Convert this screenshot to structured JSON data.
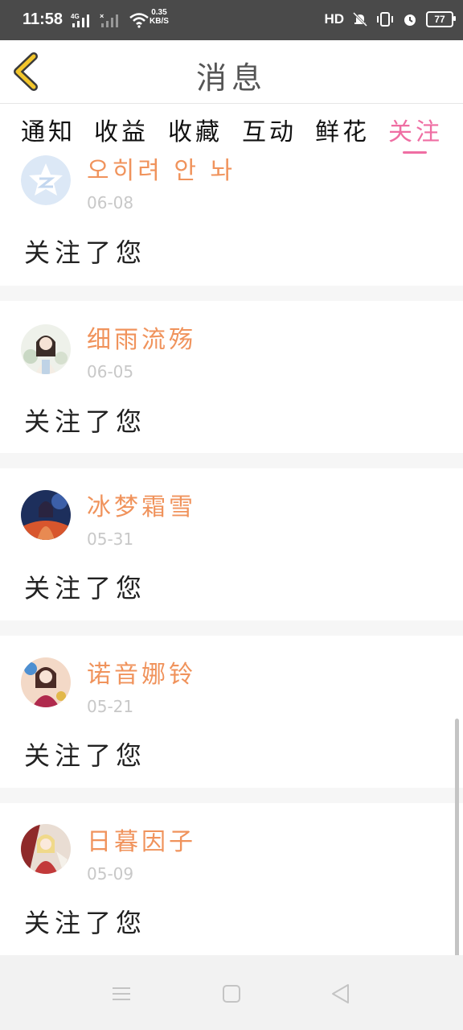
{
  "status": {
    "time": "11:58",
    "speed_value": "0.35",
    "speed_unit": "KB/S",
    "hd_label": "HD",
    "battery": "77"
  },
  "header": {
    "title": "消息"
  },
  "tabs": [
    {
      "label": "通知",
      "active": false
    },
    {
      "label": "收益",
      "active": false
    },
    {
      "label": "收藏",
      "active": false
    },
    {
      "label": "互动",
      "active": false
    },
    {
      "label": "鲜花",
      "active": false
    },
    {
      "label": "关注",
      "active": true
    }
  ],
  "colors": {
    "accent_pink": "#ef6ea3",
    "username_orange": "#f0935c",
    "back_yellow": "#f3c62b"
  },
  "items": [
    {
      "username": "오히려 안 놔",
      "date": "06-08",
      "message": "关注了您"
    },
    {
      "username": "细雨流殇",
      "date": "06-05",
      "message": "关注了您"
    },
    {
      "username": "冰梦霜雪",
      "date": "05-31",
      "message": "关注了您"
    },
    {
      "username": "诺音娜铃",
      "date": "05-21",
      "message": "关注了您"
    },
    {
      "username": "日暮因子",
      "date": "05-09",
      "message": "关注了您"
    }
  ]
}
